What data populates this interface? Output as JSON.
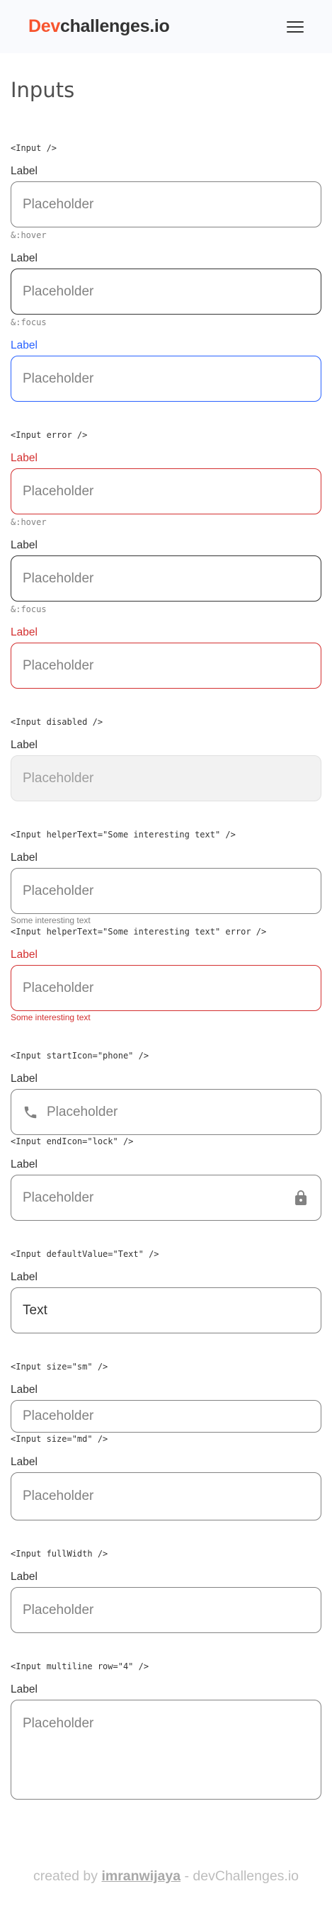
{
  "header": {
    "logo_accent": "Dev",
    "logo_rest": "challenges.io"
  },
  "page_title": "Inputs",
  "sections": {
    "default": {
      "code": "<Input />",
      "label": "Label",
      "placeholder": "Placeholder",
      "hover_state": "&:hover",
      "focus_state": "&:focus"
    },
    "error": {
      "code": "<Input error />",
      "label": "Label",
      "placeholder": "Placeholder",
      "hover_state": "&:hover",
      "focus_state": "&:focus"
    },
    "disabled": {
      "code": "<Input disabled />",
      "label": "Label",
      "placeholder": "Placeholder"
    },
    "helper": {
      "code": "<Input helperText=\"Some interesting text\" />",
      "label": "Label",
      "placeholder": "Placeholder",
      "helper_text": "Some interesting text"
    },
    "helper_error": {
      "code": "<Input helperText=\"Some interesting text\" error />",
      "label": "Label",
      "placeholder": "Placeholder",
      "helper_text": "Some interesting text"
    },
    "start_icon": {
      "code": "<Input startIcon=\"phone\" />",
      "label": "Label",
      "placeholder": "Placeholder",
      "icon": "phone-icon"
    },
    "end_icon": {
      "code": "<Input endIcon=\"lock\" />",
      "label": "Label",
      "placeholder": "Placeholder",
      "icon": "lock-icon"
    },
    "default_value": {
      "code": "<Input defaultValue=\"Text\" />",
      "label": "Label",
      "value": "Text"
    },
    "size_sm": {
      "code": "<Input size=\"sm\" />",
      "label": "Label",
      "placeholder": "Placeholder"
    },
    "size_md": {
      "code": "<Input size=\"md\" />",
      "label": "Label",
      "placeholder": "Placeholder"
    },
    "full_width": {
      "code": "<Input fullWidth />",
      "label": "Label",
      "placeholder": "Placeholder"
    },
    "multiline": {
      "code": "<Input multiline row=\"4\" />",
      "label": "Label",
      "placeholder": "Placeholder"
    }
  },
  "footer": {
    "prefix": "created by ",
    "author": "imranwijaya",
    "suffix": " - devChallenges.io"
  },
  "colors": {
    "accent": "#f7542e",
    "error": "#d32f2f",
    "focus": "#2962ff",
    "border": "#828282",
    "hover_border": "#333333",
    "disabled_bg": "#f2f2f2"
  }
}
